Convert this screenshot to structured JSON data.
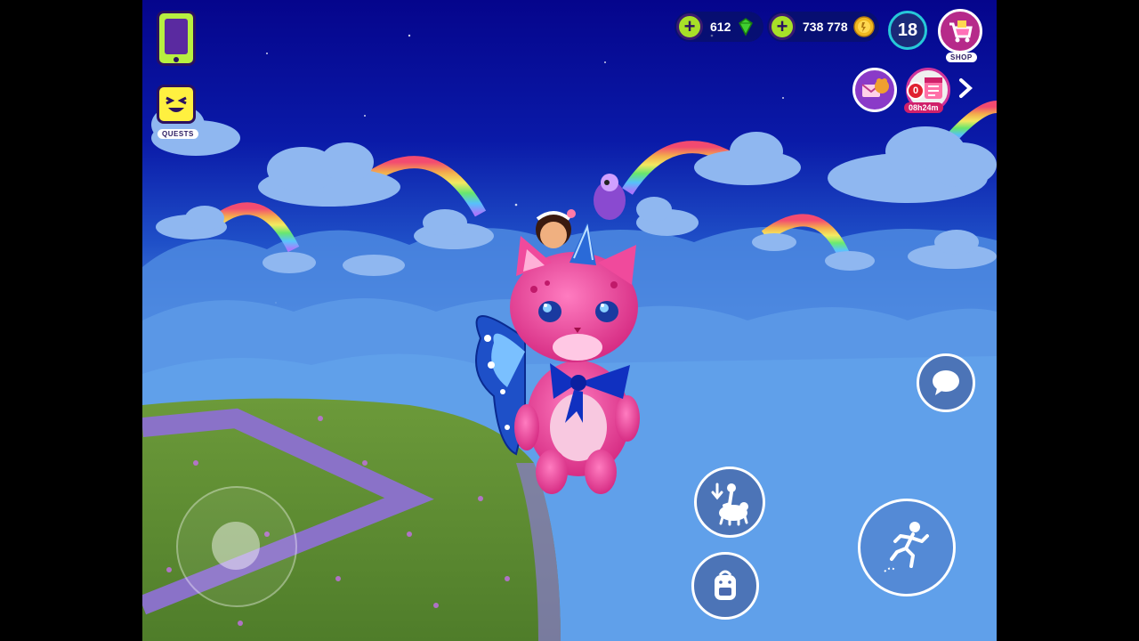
{
  "hud": {
    "gems": {
      "value": "612",
      "icon": "green-gem-icon"
    },
    "coins": {
      "value": "738 778",
      "icon": "gold-coin-icon"
    },
    "level": "18",
    "shop_label": "SHOP",
    "event_counter": "0",
    "event_timer": "08h24m"
  },
  "left_menu": {
    "quests_label": "QUESTS"
  },
  "colors": {
    "plus_green": "#a8e028",
    "level_ring": "#27c8d8",
    "shop_pink": "#d0359a",
    "sky_top": "#05058c",
    "grass": "#6f9a3a",
    "path_purple": "#8a72c8",
    "pet_pink": "#f0409a"
  }
}
